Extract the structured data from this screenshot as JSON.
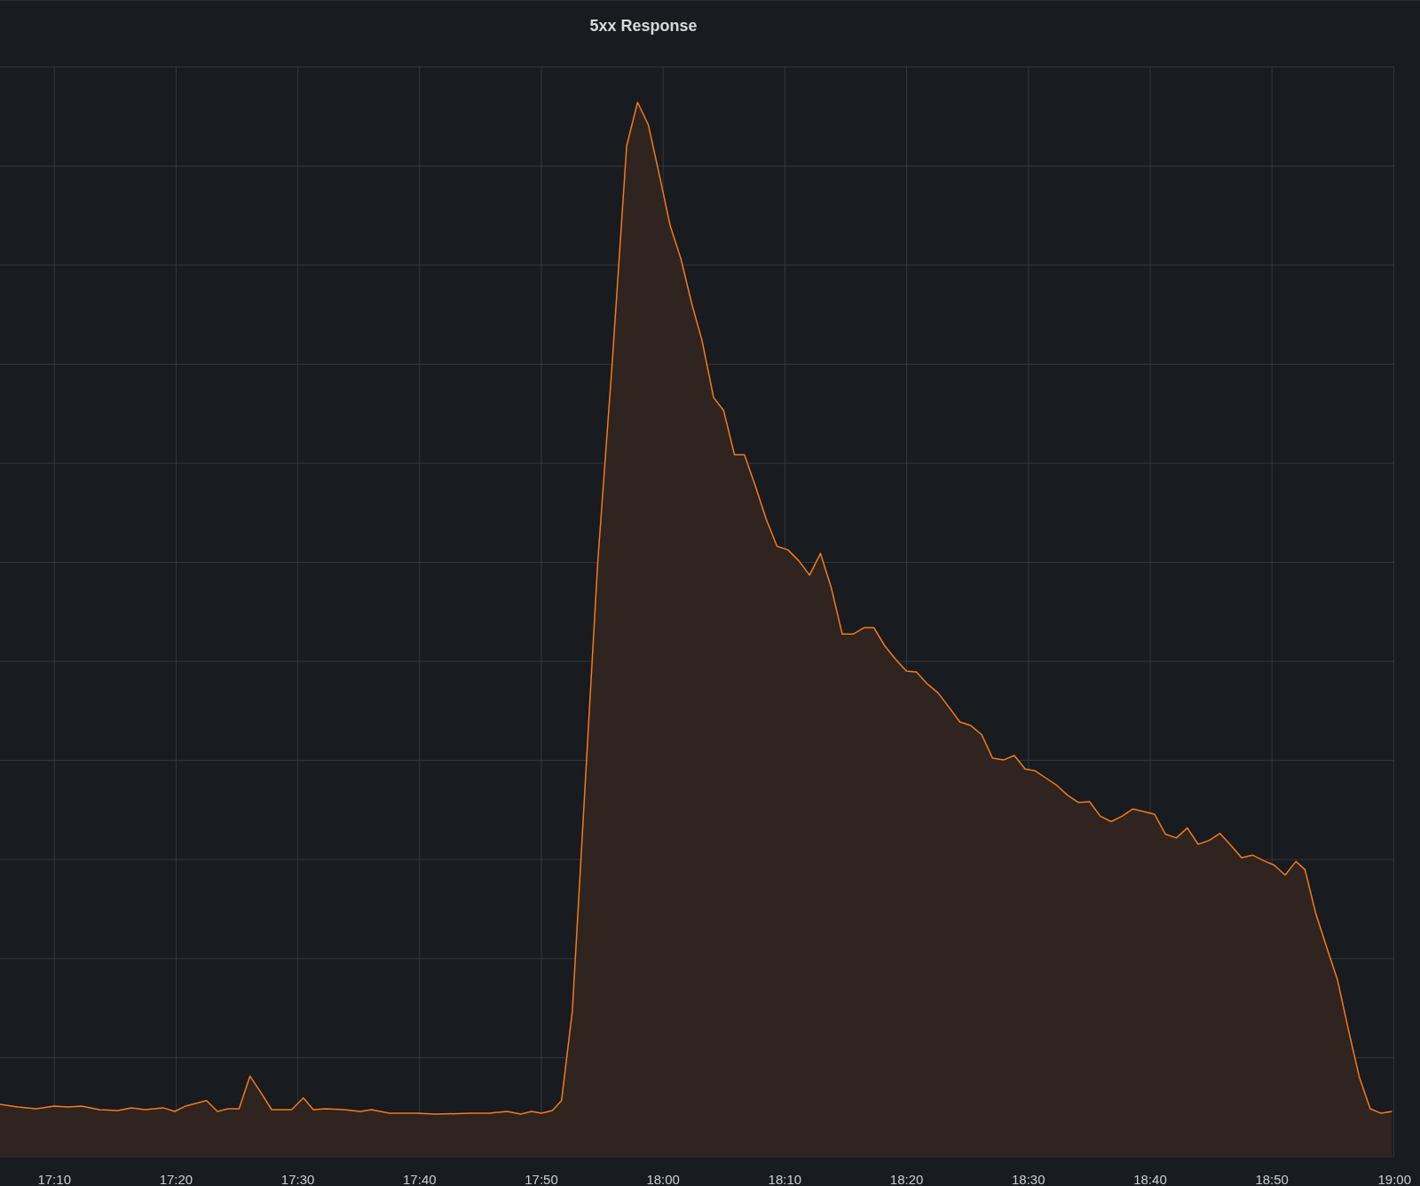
{
  "panel": {
    "title": "5xx Response",
    "x_tick_labels": [
      "17:10",
      "17:20",
      "17:30",
      "17:40",
      "17:50",
      "18:00",
      "18:10",
      "18:20",
      "18:30",
      "18:40",
      "18:50",
      "19:00"
    ]
  }
}
